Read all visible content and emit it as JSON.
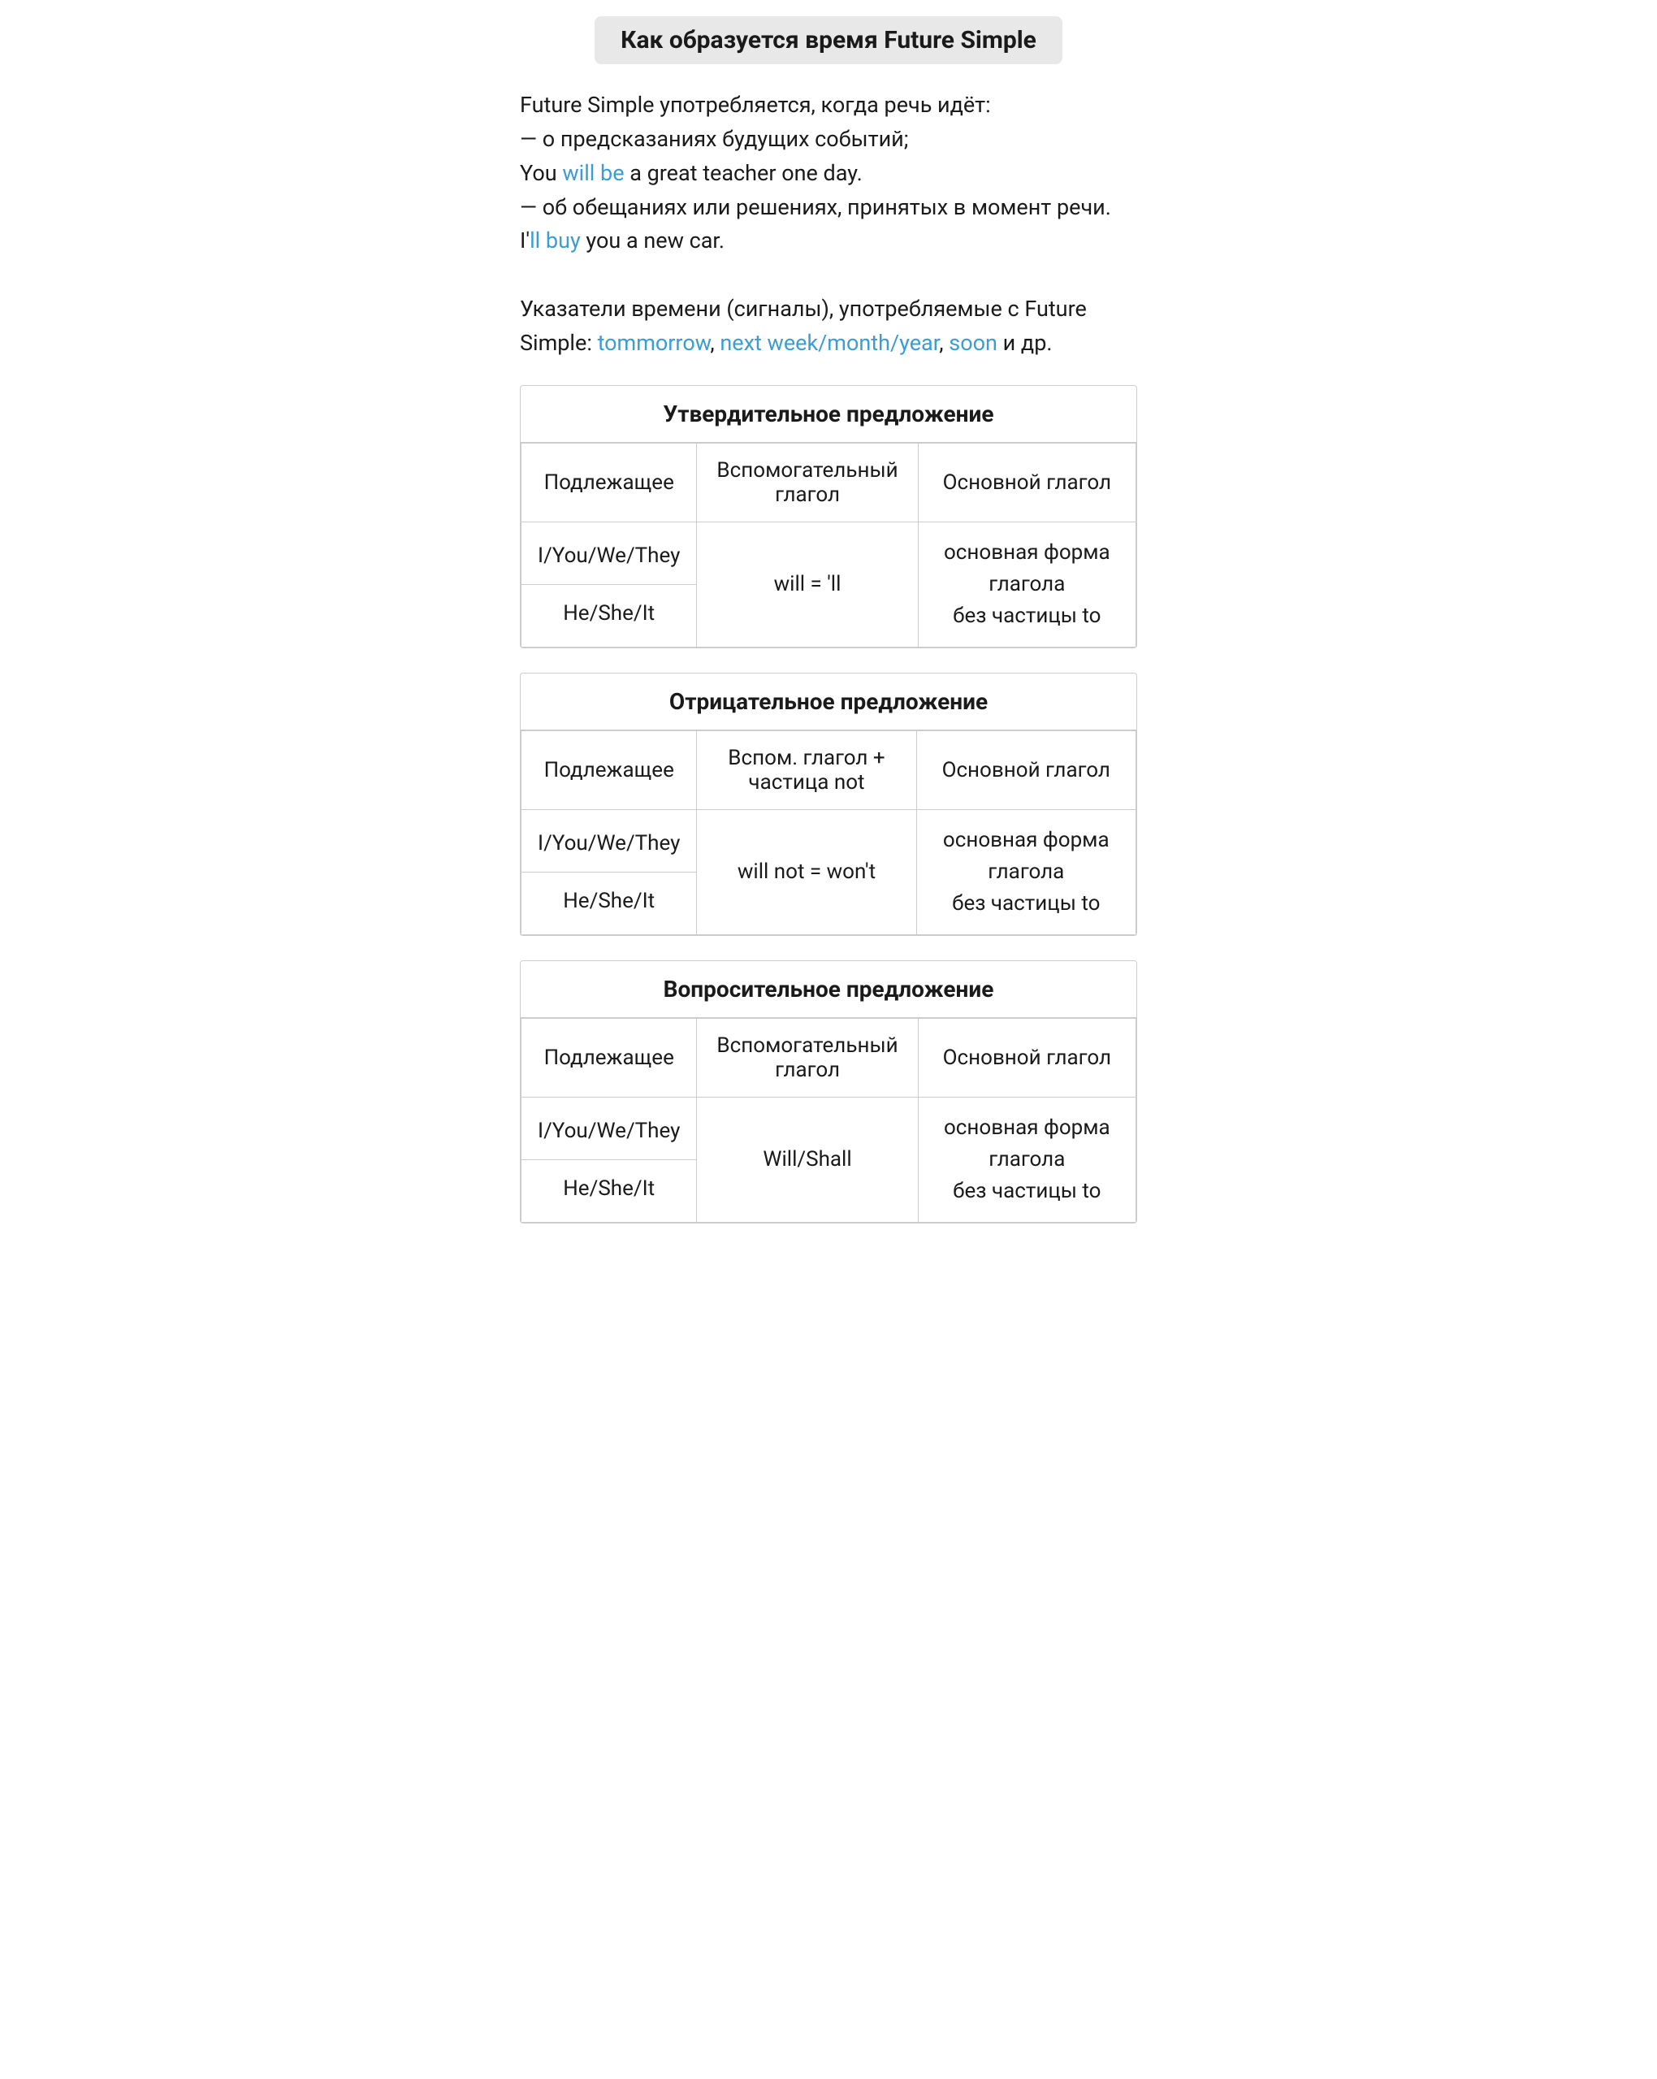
{
  "page": {
    "title": "Как образуется время Future Simple"
  },
  "intro": {
    "line1": "Future Simple употребляется, когда речь идёт:",
    "line2": "— о предсказаниях будущих событий;",
    "line3_prefix": "You ",
    "line3_highlight": "will be",
    "line3_suffix": " a great teacher one day.",
    "line4": "— об обещаниях или решениях, принятых в момент речи.",
    "line5_prefix": "I'",
    "line5_highlight": "ll buy",
    "line5_suffix": " you a new car.",
    "line6_prefix": "Указатели времени (сигналы), употребляемые с Future Simple: ",
    "signals": [
      {
        "text": "tommorrow",
        "color": "blue"
      },
      {
        "text": ", ",
        "color": "normal"
      },
      {
        "text": "next week",
        "color": "blue"
      },
      {
        "text": "/",
        "color": "blue"
      },
      {
        "text": "month",
        "color": "blue"
      },
      {
        "text": "/",
        "color": "blue"
      },
      {
        "text": "year",
        "color": "blue"
      },
      {
        "text": ", ",
        "color": "normal"
      },
      {
        "text": "soon",
        "color": "blue"
      },
      {
        "text": " и др.",
        "color": "normal"
      }
    ]
  },
  "sections": [
    {
      "id": "affirmative",
      "header": "Утвердительное предложение",
      "col1_header": "Подлежащее",
      "col2_header": "Вспомогательный глагол",
      "col3_header": "Основной глагол",
      "subject_top": "I/You/We/They",
      "subject_bottom": "He/She/It",
      "aux_verb": "will = 'll",
      "main_verb_line1": "основная форма глагола",
      "main_verb_line2": "без частицы to"
    },
    {
      "id": "negative",
      "header": "Отрицательное предложение",
      "col1_header": "Подлежащее",
      "col2_header": "Вспом. глагол + частица not",
      "col3_header": "Основной глагол",
      "subject_top": "I/You/We/They",
      "subject_bottom": "He/She/It",
      "aux_verb": "will not = won't",
      "main_verb_line1": "основная форма глагола",
      "main_verb_line2": "без частицы to"
    },
    {
      "id": "interrogative",
      "header": "Вопросительное предложение",
      "col1_header": "Подлежащее",
      "col2_header": "Вспомогательный глагол",
      "col3_header": "Основной глагол",
      "subject_top": "I/You/We/They",
      "subject_bottom": "He/She/It",
      "aux_verb": "Will/Shall",
      "main_verb_line1": "основная форма глагола",
      "main_verb_line2": "без частицы to"
    }
  ]
}
